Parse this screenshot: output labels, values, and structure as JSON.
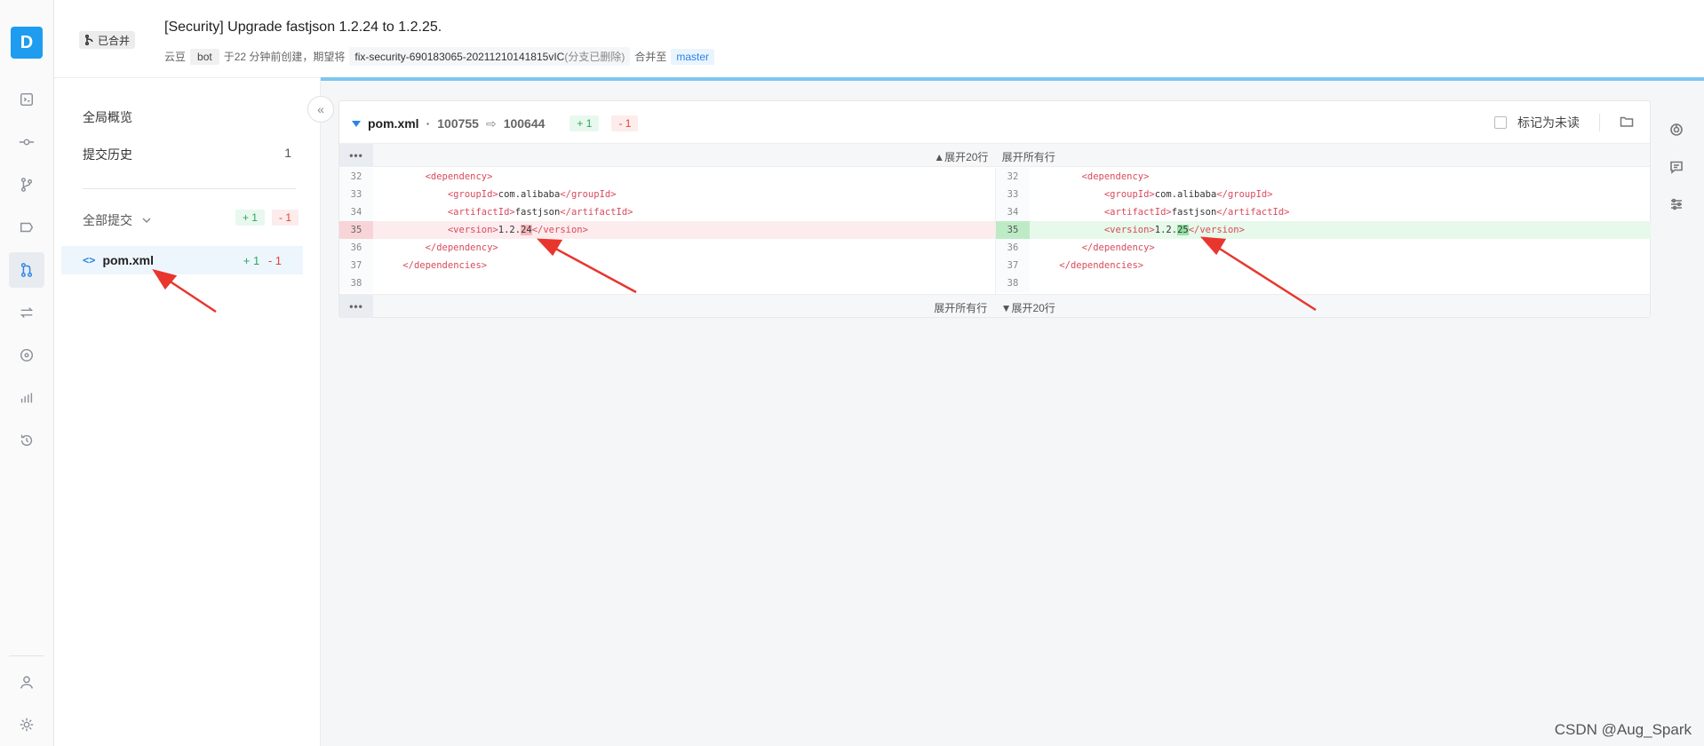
{
  "rail": {
    "avatar_letter": "D",
    "items": [
      {
        "name": "code-icon"
      },
      {
        "name": "commit-icon"
      },
      {
        "name": "branch-icon"
      },
      {
        "name": "tag-icon"
      },
      {
        "name": "merge-request-icon",
        "active": true
      },
      {
        "name": "compare-icon"
      },
      {
        "name": "pipeline-icon"
      },
      {
        "name": "stats-icon"
      },
      {
        "name": "history-icon"
      }
    ],
    "bottom": [
      {
        "name": "user-icon"
      },
      {
        "name": "settings-icon"
      }
    ]
  },
  "header": {
    "status": "已合并",
    "title": "[Security] Upgrade fastjson 1.2.24 to 1.2.25.",
    "author": "云豆",
    "author_tag": "bot",
    "created_text": "于22 分钟前创建，期望将",
    "source_branch": "fix-security-690183065-20211210141815vIC",
    "source_branch_note": "(分支已删除)",
    "merge_to_text": "合并至",
    "target_branch": "master"
  },
  "sidebar": {
    "overview": "全局概览",
    "history": "提交历史",
    "history_count": "1",
    "all_commits": "全部提交",
    "all_add": "+ 1",
    "all_del": "- 1",
    "file": {
      "name": "pom.xml",
      "add": "+ 1",
      "del": "- 1"
    },
    "collapse_icon": "«"
  },
  "diff": {
    "filename": "pom.xml",
    "sep": "·",
    "mode_old": "100755",
    "mode_new": "100644",
    "add": "+ 1",
    "del": "- 1",
    "mark_unread": "标记为未读",
    "expand_top": {
      "up20": "▲展开20行",
      "all": "展开所有行"
    },
    "expand_bottom": {
      "all": "展开所有行",
      "down20": "▼展开20行"
    },
    "dots": "•••",
    "left": [
      {
        "n": "32",
        "indent": "        ",
        "open": "<dependency>",
        "text": "",
        "close": "",
        "type": ""
      },
      {
        "n": "33",
        "indent": "            ",
        "open": "<groupId>",
        "text": "com.alibaba",
        "close": "</groupId>",
        "type": ""
      },
      {
        "n": "34",
        "indent": "            ",
        "open": "<artifactId>",
        "text": "fastjson",
        "close": "</artifactId>",
        "type": ""
      },
      {
        "n": "35",
        "indent": "            ",
        "open": "<version>",
        "text": "1.2.",
        "hl": "24",
        "close": "</version>",
        "type": "del"
      },
      {
        "n": "36",
        "indent": "        ",
        "open": "</dependency>",
        "text": "",
        "close": "",
        "type": ""
      },
      {
        "n": "37",
        "indent": "    ",
        "open": "</dependencies>",
        "text": "",
        "close": "",
        "type": ""
      },
      {
        "n": "38",
        "indent": "",
        "open": "",
        "text": "",
        "close": "",
        "type": ""
      }
    ],
    "right": [
      {
        "n": "32",
        "indent": "        ",
        "open": "<dependency>",
        "text": "",
        "close": "",
        "type": ""
      },
      {
        "n": "33",
        "indent": "            ",
        "open": "<groupId>",
        "text": "com.alibaba",
        "close": "</groupId>",
        "type": ""
      },
      {
        "n": "34",
        "indent": "            ",
        "open": "<artifactId>",
        "text": "fastjson",
        "close": "</artifactId>",
        "type": ""
      },
      {
        "n": "35",
        "indent": "            ",
        "open": "<version>",
        "text": "1.2.",
        "hl": "25",
        "close": "</version>",
        "type": "add"
      },
      {
        "n": "36",
        "indent": "        ",
        "open": "</dependency>",
        "text": "",
        "close": "",
        "type": ""
      },
      {
        "n": "37",
        "indent": "    ",
        "open": "</dependencies>",
        "text": "",
        "close": "",
        "type": ""
      },
      {
        "n": "38",
        "indent": "",
        "open": "",
        "text": "",
        "close": "",
        "type": ""
      }
    ]
  },
  "side_tools": [
    {
      "name": "reviewer-icon"
    },
    {
      "name": "comment-icon"
    },
    {
      "name": "filter-icon"
    }
  ],
  "watermark": "CSDN @Aug_Spark",
  "colors": {
    "accent": "#2a84e8",
    "add": "#2ca65a",
    "del": "#e0443a",
    "annotation": "#e8362e"
  }
}
